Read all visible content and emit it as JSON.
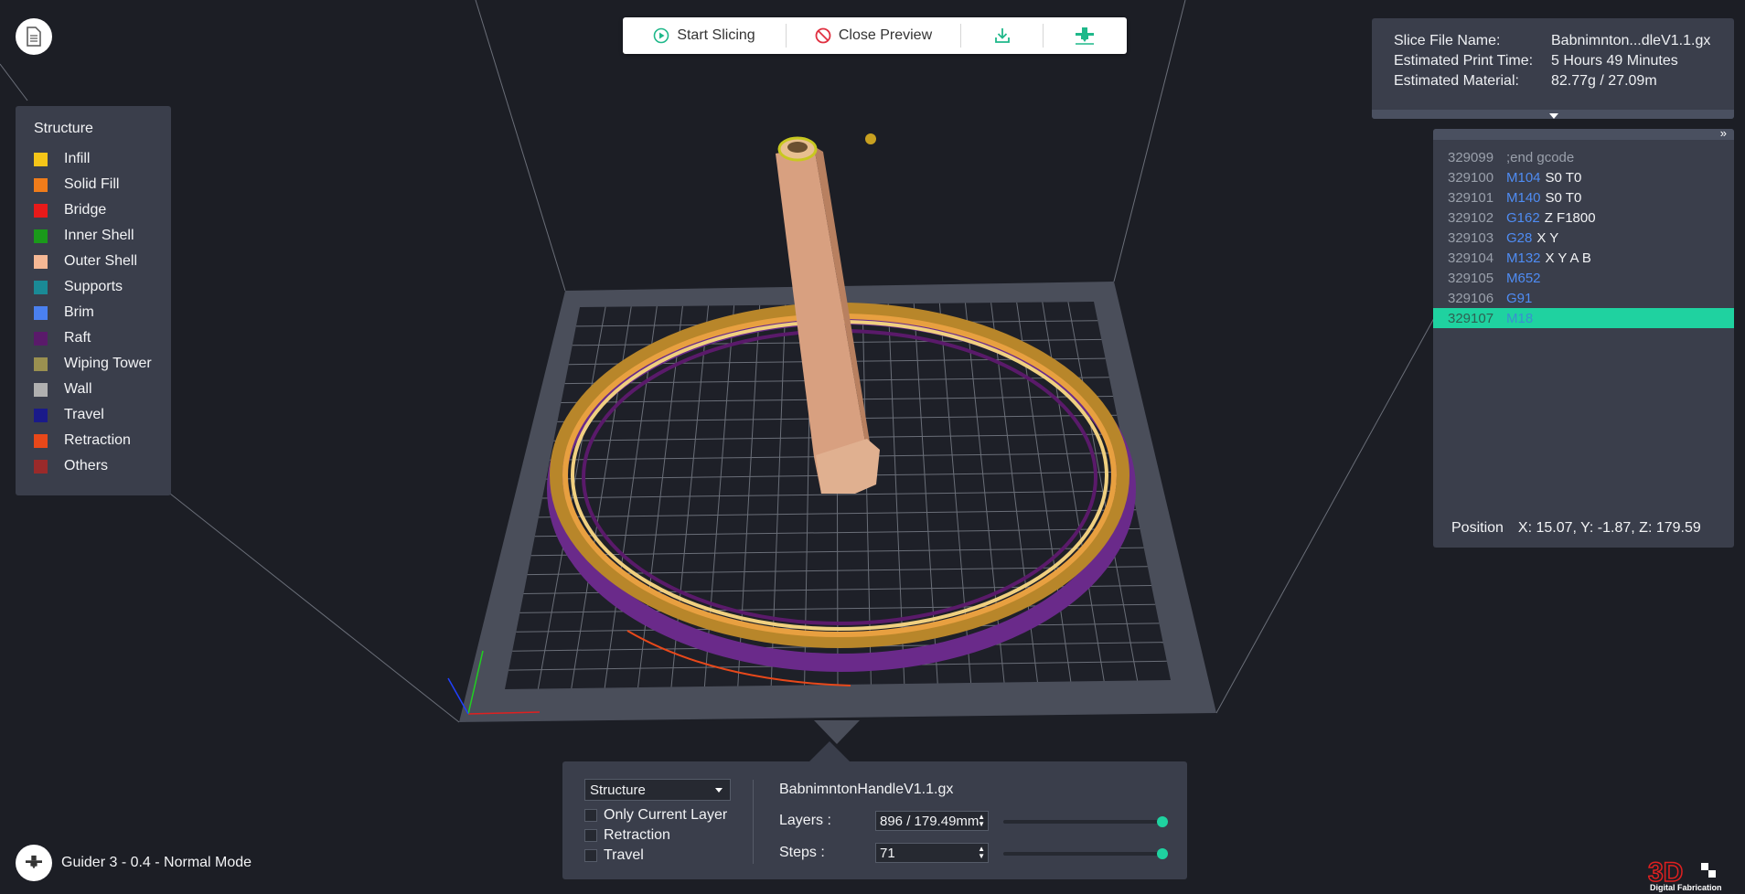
{
  "toolbar": {
    "start_slicing": "Start Slicing",
    "close_preview": "Close Preview"
  },
  "legend": {
    "title": "Structure",
    "items": [
      {
        "label": "Infill",
        "color": "#f5c518"
      },
      {
        "label": "Solid Fill",
        "color": "#f07c1a"
      },
      {
        "label": "Bridge",
        "color": "#e81a1a"
      },
      {
        "label": "Inner Shell",
        "color": "#1a9a1a"
      },
      {
        "label": "Outer Shell",
        "color": "#f5b895"
      },
      {
        "label": "Supports",
        "color": "#1a8a96"
      },
      {
        "label": "Brim",
        "color": "#4a80f0"
      },
      {
        "label": "Raft",
        "color": "#5a1a6a"
      },
      {
        "label": "Wiping Tower",
        "color": "#9a9050"
      },
      {
        "label": "Wall",
        "color": "#b0b0b0"
      },
      {
        "label": "Travel",
        "color": "#1a1a8a"
      },
      {
        "label": "Retraction",
        "color": "#e8481a"
      },
      {
        "label": "Others",
        "color": "#9a2a2a"
      }
    ]
  },
  "info": {
    "file_label": "Slice File Name:",
    "file_value": "Babnimnton...dleV1.1.gx",
    "time_label": "Estimated Print Time:",
    "time_value": "5 Hours 49 Minutes",
    "material_label": "Estimated Material:",
    "material_value": "82.77g / 27.09m"
  },
  "gcode": {
    "collapse": "»",
    "lines": [
      {
        "num": "329099",
        "cmd": ";end gcode",
        "args": "",
        "comment": true
      },
      {
        "num": "329100",
        "cmd": "M104",
        "args": "S0 T0"
      },
      {
        "num": "329101",
        "cmd": "M140",
        "args": "S0 T0"
      },
      {
        "num": "329102",
        "cmd": "G162",
        "args": "Z F1800"
      },
      {
        "num": "329103",
        "cmd": "G28",
        "args": "X Y"
      },
      {
        "num": "329104",
        "cmd": "M132",
        "args": "X Y A B"
      },
      {
        "num": "329105",
        "cmd": "M652",
        "args": ""
      },
      {
        "num": "329106",
        "cmd": "G91",
        "args": ""
      },
      {
        "num": "329107",
        "cmd": "M18",
        "args": "",
        "active": true
      }
    ],
    "position_label": "Position",
    "position_value": "X: 15.07, Y: -1.87, Z: 179.59"
  },
  "controls": {
    "view_select": "Structure",
    "only_current_layer": "Only Current Layer",
    "retraction": "Retraction",
    "travel": "Travel",
    "file_name": "BabnimntonHandleV1.1.gx",
    "layers_label": "Layers :",
    "layers_value": "896 / 179.49mm",
    "layers_slider": 1.0,
    "steps_label": "Steps :",
    "steps_value": "71",
    "steps_slider": 1.0
  },
  "status": {
    "printer": "Guider 3 - 0.4 - Normal Mode"
  },
  "logo": {
    "brand": "3D",
    "tagline": "Digital Fabrication"
  }
}
